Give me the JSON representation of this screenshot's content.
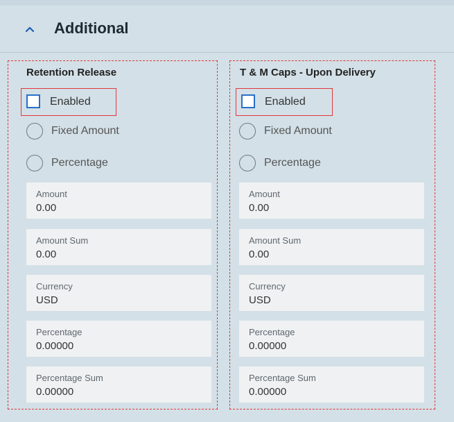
{
  "section": {
    "title": "Additional"
  },
  "columns": [
    {
      "title": "Retention Release",
      "enabled_label": "Enabled",
      "enabled_checked": false,
      "radios": [
        "Fixed Amount",
        "Percentage"
      ],
      "fields": [
        {
          "label": "Amount",
          "value": "0.00"
        },
        {
          "label": "Amount Sum",
          "value": "0.00"
        },
        {
          "label": "Currency",
          "value": "USD"
        },
        {
          "label": "Percentage",
          "value": "0.00000"
        },
        {
          "label": "Percentage Sum",
          "value": "0.00000"
        }
      ]
    },
    {
      "title": "T & M Caps - Upon Delivery",
      "enabled_label": "Enabled",
      "enabled_checked": false,
      "radios": [
        "Fixed Amount",
        "Percentage"
      ],
      "fields": [
        {
          "label": "Amount",
          "value": "0.00"
        },
        {
          "label": "Amount Sum",
          "value": "0.00"
        },
        {
          "label": "Currency",
          "value": "USD"
        },
        {
          "label": "Percentage",
          "value": "0.00000"
        },
        {
          "label": "Percentage Sum",
          "value": "0.00000"
        }
      ]
    }
  ],
  "colors": {
    "background": "#d3e0e7",
    "highlight": "#e0383a",
    "checkbox": "#2a6fc9",
    "field_bg": "#f0f1f2"
  },
  "icons": {
    "collapse": "chevron-up-icon"
  }
}
